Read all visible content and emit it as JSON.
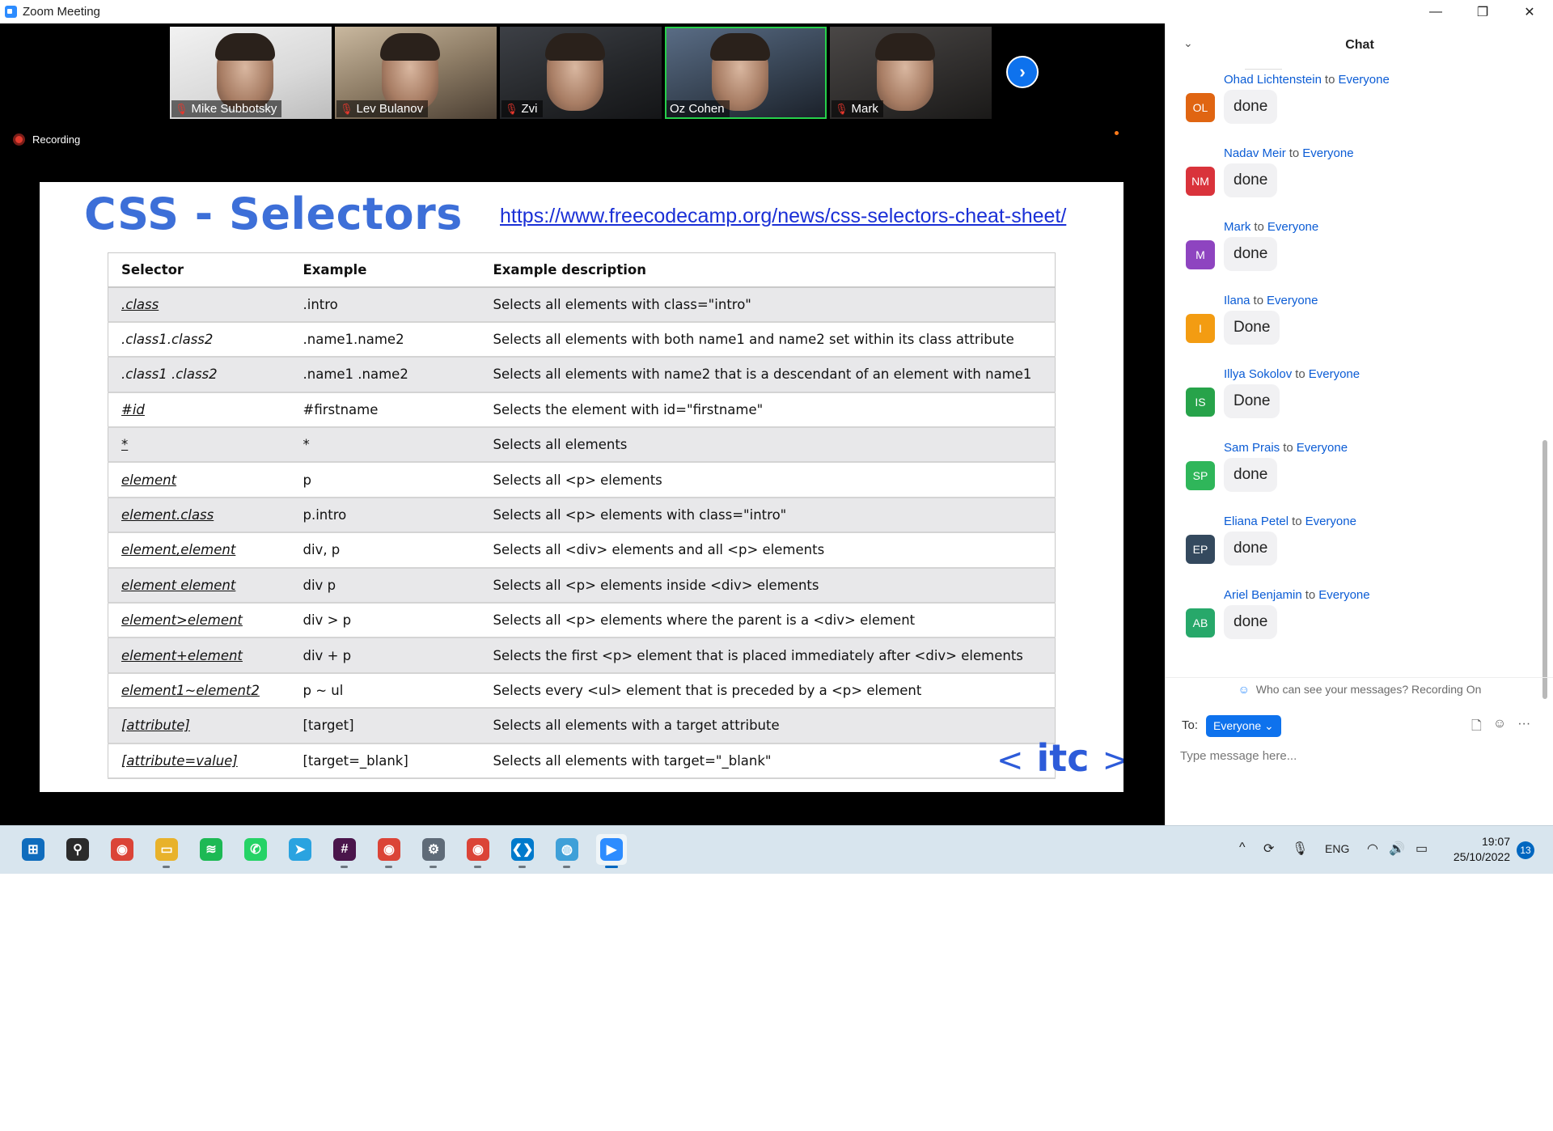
{
  "window": {
    "title": "Zoom Meeting",
    "controls": [
      "—",
      "❐",
      "✕"
    ]
  },
  "gallery": {
    "participants": [
      {
        "name": "Mike Subbotsky",
        "muted": true
      },
      {
        "name": "Lev Bulanov",
        "muted": true
      },
      {
        "name": "Zvi",
        "muted": true
      },
      {
        "name": "Oz Cohen",
        "muted": false
      },
      {
        "name": "Mark",
        "muted": true
      }
    ],
    "next_icon": "›",
    "mute_icon": "🎙"
  },
  "recording": {
    "label": "Recording"
  },
  "slide": {
    "title": "CSS - Selectors",
    "link": "https://www.freecodecamp.org/news/css-selectors-cheat-sheet/",
    "headers": [
      "Selector",
      "Example",
      "Example description"
    ],
    "rows": [
      {
        "selector": ".class",
        "underline": true,
        "example": ".intro",
        "description": "Selects all elements with class=\"intro\""
      },
      {
        "selector": ".class1.class2",
        "underline": false,
        "example": ".name1.name2",
        "description": "Selects all elements with both name1 and name2 set within its class attribute"
      },
      {
        "selector": ".class1 .class2",
        "underline": false,
        "example": ".name1 .name2",
        "description": "Selects all elements with name2 that is a descendant of an element with name1"
      },
      {
        "selector": "#id",
        "underline": true,
        "example": "#firstname",
        "description": "Selects the element with id=\"firstname\""
      },
      {
        "selector": "*",
        "underline": true,
        "example": "*",
        "description": "Selects all elements"
      },
      {
        "selector": "element",
        "underline": true,
        "example": "p",
        "description": "Selects all <p> elements"
      },
      {
        "selector": "element.class",
        "underline": true,
        "example": "p.intro",
        "description": "Selects all <p> elements with class=\"intro\""
      },
      {
        "selector": "element,element",
        "underline": true,
        "example": "div, p",
        "description": "Selects all <div> elements and all <p> elements"
      },
      {
        "selector": "element element",
        "underline": true,
        "example": "div p",
        "description": "Selects all <p> elements inside <div> elements"
      },
      {
        "selector": "element>element",
        "underline": true,
        "example": "div > p",
        "description": "Selects all <p> elements where the parent is a <div> element"
      },
      {
        "selector": "element+element",
        "underline": true,
        "example": "div + p",
        "description": "Selects the first <p> element that is placed immediately after <div> elements"
      },
      {
        "selector": "element1~element2",
        "underline": true,
        "example": "p ~ ul",
        "description": "Selects every <ul> element that is preceded by a <p> element"
      },
      {
        "selector": "[attribute]",
        "underline": true,
        "example": "[target]",
        "description": "Selects all elements with a target attribute"
      },
      {
        "selector": "[attribute=value]",
        "underline": true,
        "example": "[target=_blank]",
        "description": "Selects all elements with target=\"_blank\""
      }
    ],
    "logo": {
      "left": "<",
      "text": "itc",
      "right": ">"
    }
  },
  "chat": {
    "title": "Chat",
    "collapse_icon": "⌄",
    "messages": [
      {
        "sender": "Ohad Lichtenstein",
        "to": "to",
        "recipient": "Everyone",
        "initials": "OL",
        "color": "#e06512",
        "text": "done"
      },
      {
        "sender": "Nadav Meir",
        "to": "to",
        "recipient": "Everyone",
        "initials": "NM",
        "color": "#d9333b",
        "text": "done"
      },
      {
        "sender": "Mark",
        "to": "to",
        "recipient": "Everyone",
        "initials": "M",
        "color": "#8e44c0",
        "text": "done"
      },
      {
        "sender": "Ilana",
        "to": "to",
        "recipient": "Everyone",
        "initials": "I",
        "color": "#f39c12",
        "text": "Done"
      },
      {
        "sender": "Illya Sokolov",
        "to": "to",
        "recipient": "Everyone",
        "initials": "IS",
        "color": "#27a34a",
        "text": "Done"
      },
      {
        "sender": "Sam Prais",
        "to": "to",
        "recipient": "Everyone",
        "initials": "SP",
        "color": "#2fb65a",
        "text": "done"
      },
      {
        "sender": "Eliana Petel",
        "to": "to",
        "recipient": "Everyone",
        "initials": "EP",
        "color": "#34495e",
        "text": "done"
      },
      {
        "sender": "Ariel Benjamin",
        "to": "to",
        "recipient": "Everyone",
        "initials": "AB",
        "color": "#27a86a",
        "text": "done"
      }
    ],
    "visibility_note": "Who can see your messages? Recording On",
    "to_label": "To:",
    "to_value": "Everyone ⌄",
    "input_placeholder": "Type message here...",
    "tool_icons": [
      "🗋",
      "☺",
      "···"
    ]
  },
  "taskbar": {
    "apps": [
      {
        "name": "start-icon",
        "glyph": "⊞",
        "color": "#0f6cbd",
        "running": false,
        "active": false
      },
      {
        "name": "search-icon",
        "glyph": "⚲",
        "color": "#2b2b2b",
        "running": false,
        "active": false
      },
      {
        "name": "chrome-icon",
        "glyph": "◉",
        "color": "#db4437",
        "running": false,
        "active": false
      },
      {
        "name": "file-explorer-icon",
        "glyph": "▭",
        "color": "#e8b22b",
        "running": true,
        "active": false
      },
      {
        "name": "spotify-icon",
        "glyph": "≋",
        "color": "#1db954",
        "running": false,
        "active": false
      },
      {
        "name": "whatsapp-icon",
        "glyph": "✆",
        "color": "#25d366",
        "running": false,
        "active": false
      },
      {
        "name": "telegram-icon",
        "glyph": "➤",
        "color": "#2aa3e0",
        "running": false,
        "active": false
      },
      {
        "name": "slack-icon",
        "glyph": "#",
        "color": "#4a154b",
        "running": true,
        "active": false
      },
      {
        "name": "chrome-profile-icon",
        "glyph": "◉",
        "color": "#db4437",
        "running": true,
        "active": false
      },
      {
        "name": "settings-icon",
        "glyph": "⚙",
        "color": "#5f6b78",
        "running": true,
        "active": false
      },
      {
        "name": "chrome-alt-icon",
        "glyph": "◉",
        "color": "#db4437",
        "running": true,
        "active": false
      },
      {
        "name": "vscode-icon",
        "glyph": "❮❯",
        "color": "#007acc",
        "running": true,
        "active": false
      },
      {
        "name": "globe-app-icon",
        "glyph": "◍",
        "color": "#3fa0d8",
        "running": true,
        "active": false
      },
      {
        "name": "zoom-icon",
        "glyph": "▶",
        "color": "#2d8cff",
        "running": true,
        "active": true
      }
    ],
    "tray": {
      "chevron": "^",
      "sync": "⟳",
      "mic": "🎙",
      "lang": "ENG",
      "wifi": "◠",
      "volume": "🔊",
      "battery": "▭"
    },
    "time": "19:07",
    "date": "25/10/2022",
    "notifications": "13"
  }
}
